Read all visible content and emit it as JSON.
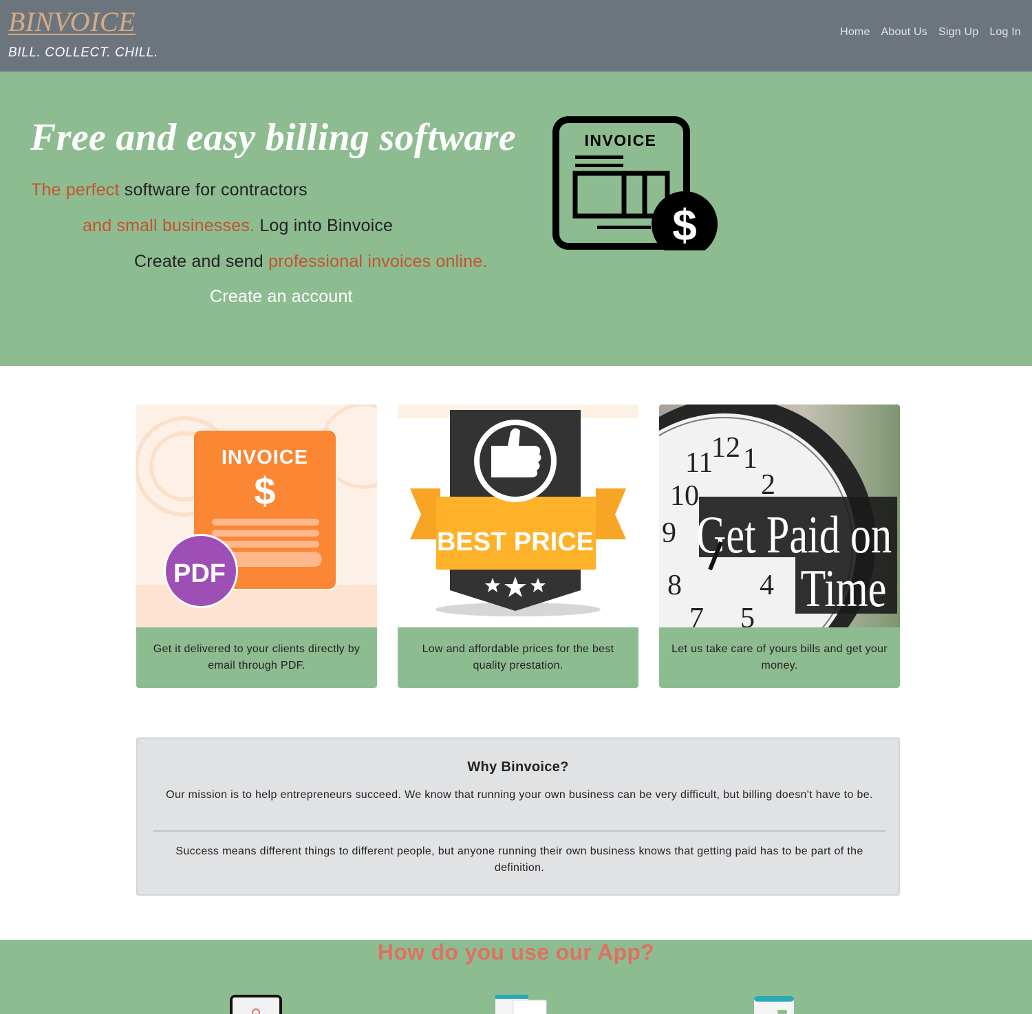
{
  "navbar": {
    "brand": "BINVOICE",
    "tagline": "BILL. COLLECT. CHILL.",
    "links": [
      "Home",
      "About Us",
      "Sign Up",
      "Log In"
    ]
  },
  "hero": {
    "title": "Free and easy billing software",
    "line1": {
      "highlight": "The perfect",
      "rest": " software for contractors"
    },
    "line2": {
      "highlight": "and small businesses.",
      "rest": " Log into Binvoice"
    },
    "line3": {
      "rest": "Create and send ",
      "highlight": "professional invoices online."
    },
    "cta": "Create an account",
    "icon_label": "INVOICE",
    "icon_symbol": "$"
  },
  "cards": [
    {
      "image_title": "INVOICE",
      "image_symbol": "$",
      "image_badge": "PDF",
      "text": "Get it delivered to your clients directly by email through PDF."
    },
    {
      "image_title": "BEST PRICE",
      "text": "Low and affordable prices for the best quality prestation."
    },
    {
      "image_title_1": "Get Paid on",
      "image_title_2": "Time",
      "text": "Let us take care of yours bills and get your money."
    }
  ],
  "why": {
    "title": "Why Binvoice?",
    "p1": "Our mission is to help entrepreneurs succeed. We know that running your own business can be very difficult, but billing doesn't have to be.",
    "p2": "Success means different things to different people, but anyone running their own business knows that getting paid has to be part of the definition."
  },
  "how": {
    "title": "How do you use our App?"
  },
  "colors": {
    "navbar_bg": "#6c757d",
    "brand": "#d8ab82",
    "hero_bg": "#8dbc91",
    "accent": "#c4532f",
    "how_title": "#e07062",
    "why_bg": "#e1e2e4"
  }
}
